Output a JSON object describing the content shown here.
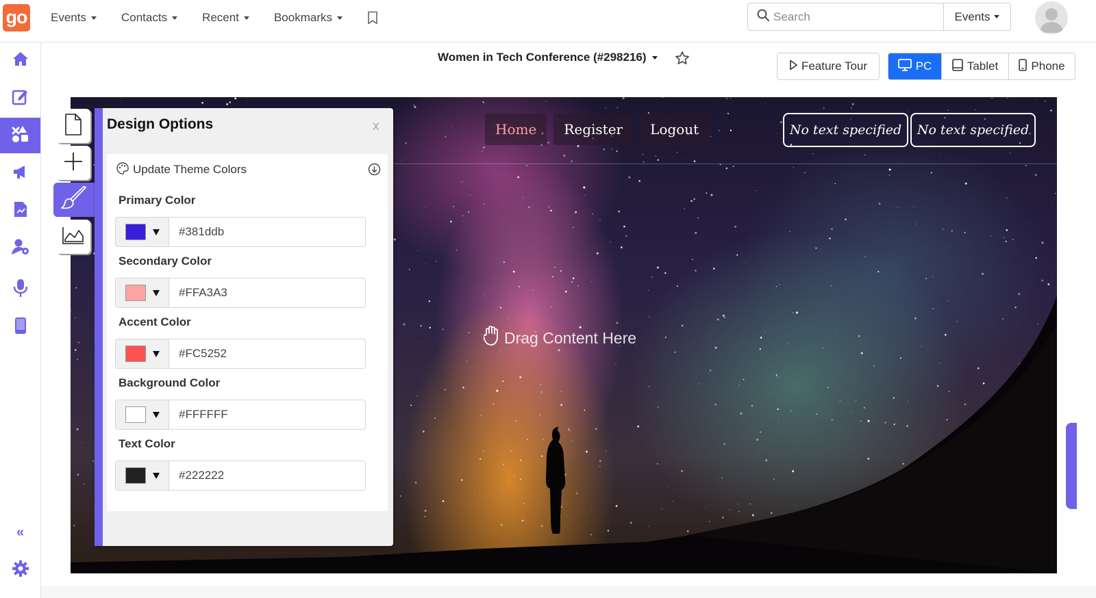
{
  "app": {
    "logo_text": "go"
  },
  "topnav": {
    "items": [
      {
        "label": "Events"
      },
      {
        "label": "Contacts"
      },
      {
        "label": "Recent"
      },
      {
        "label": "Bookmarks"
      }
    ]
  },
  "search": {
    "placeholder": "Search",
    "scope": "Events"
  },
  "sidebar": {
    "items": [
      "home-icon",
      "edit-icon",
      "design-icon",
      "megaphone-icon",
      "report-icon",
      "user-settings-icon",
      "microphone-icon",
      "mobile-icon"
    ],
    "active": "design-icon",
    "collapse": "«"
  },
  "editor": {
    "event_title": "Women in Tech Conference (#298216)",
    "feature_tour": "Feature Tour",
    "devices": [
      "PC",
      "Tablet",
      "Phone"
    ],
    "active_device": "PC"
  },
  "canvas": {
    "nav_links": [
      "Home",
      "Register",
      "Logout"
    ],
    "buttons": [
      "No text specified",
      "No text specified"
    ],
    "drag_hint": "Drag Content Here"
  },
  "design_panel": {
    "title": "Design Options",
    "close": "x",
    "theme_button": "Update Theme Colors",
    "colors": [
      {
        "label": "Primary Color",
        "value": "#381ddb",
        "swatch": "#381ddb"
      },
      {
        "label": "Secondary Color",
        "value": "#FFA3A3",
        "swatch": "#FFA3A3"
      },
      {
        "label": "Accent Color",
        "value": "#FC5252",
        "swatch": "#FC5252"
      },
      {
        "label": "Background Color",
        "value": "#FFFFFF",
        "swatch": "#FFFFFF"
      },
      {
        "label": "Text Color",
        "value": "#222222",
        "swatch": "#222222"
      }
    ]
  },
  "theme": {
    "accent": "#6f62e8",
    "primary_blue": "#1a6ef5",
    "logo_orange": "#f26b3a"
  }
}
